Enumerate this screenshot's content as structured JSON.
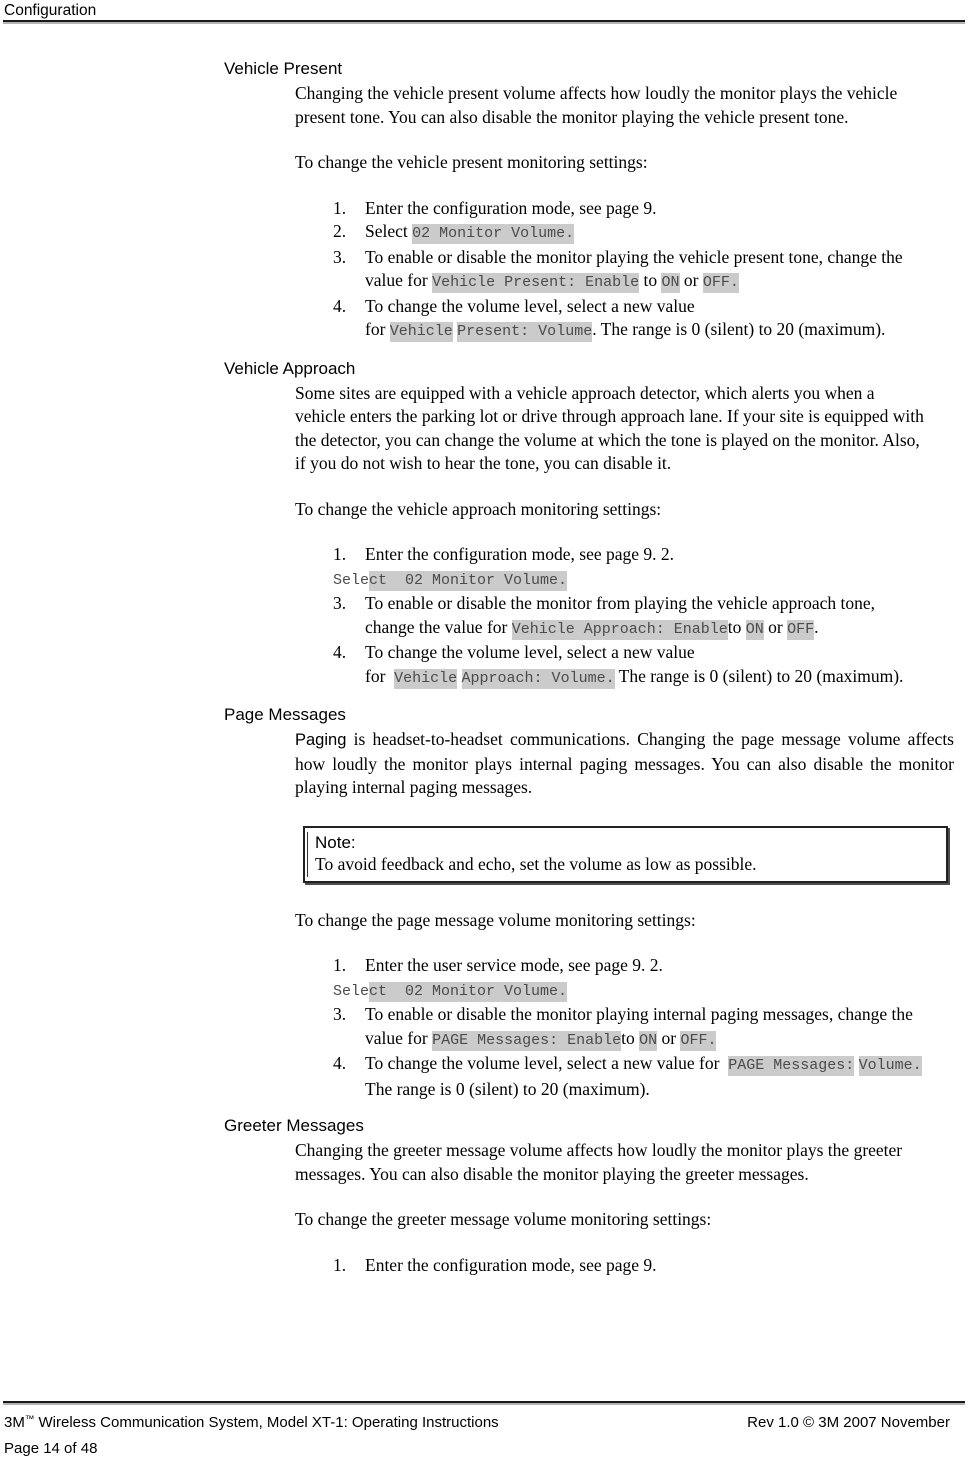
{
  "header": {
    "title": "Configuration"
  },
  "sections": [
    {
      "heading": "Vehicle Present",
      "paragraph": "Changing the vehicle present volume affects how loudly the monitor plays the vehicle present tone.  You can also disable the monitor playing the vehicle present tone.",
      "lead_in": "To change the vehicle present monitoring settings:",
      "steps": {
        "n1": "1.",
        "s1": "Enter the configuration mode, see page 9.",
        "n2": "2.",
        "s2_pre": "Select",
        "s2_code": "02 Monitor Volume.",
        "n3": "3.",
        "s3_pre": "To enable or disable the monitor playing the vehicle present tone, change the value for",
        "s3_code1": "Vehicle Present: Enable",
        "s3_mid1": "to",
        "s3_code2": "ON",
        "s3_mid2": "or",
        "s3_code3": "OFF.",
        "n4": "4.",
        "s4_pre": "To change the volume level, select a new value for",
        "s4_code1": "Vehicle",
        "s4_code2": "Present: Volume",
        "s4_post": ".  The range is 0 (silent) to 20 (maximum)."
      }
    },
    {
      "heading": "Vehicle Approach",
      "paragraph": "Some sites are equipped with a vehicle approach detector, which alerts you when a vehicle enters the parking lot or drive through approach lane.  If your site is equipped with the detector, you can change the volume at which the tone is played on the monitor.  Also, if you do not wish to hear the tone, you can disable it.",
      "lead_in": "To change the vehicle approach monitoring settings:",
      "steps": {
        "n1": "1.",
        "s1": "Enter the configuration mode, see page 9. 2.",
        "s2_pre": "Sele",
        "s2_code": "ct  02 Monitor Volume.",
        "n3": "3.",
        "s3_pre": "To enable or disable the monitor from playing the vehicle approach tone, change the value for",
        "s3_code1": "Vehicle Approach: Enable",
        "s3_mid1": "to",
        "s3_code2": "ON",
        "s3_mid2": "or",
        "s3_code3": "OFF",
        "s3_post": ".",
        "n4": "4.",
        "s4_pre": "To change the volume level, select a new value for",
        "s4_code1": "Vehicle",
        "s4_code2": "Approach: Volume.",
        "s4_post": "  The range is 0 (silent) to 20 (maximum)."
      }
    },
    {
      "heading": "Page Messages",
      "paragraph_lead": "Paging",
      "paragraph": " is headset-to-headset communications.  Changing the page message volume affects how loudly the monitor plays internal paging messages.  You can also disable the monitor playing internal paging messages.",
      "note": {
        "title": "Note:",
        "text": "To avoid feedback and echo, set the volume as low as possible."
      },
      "lead_in": "To change the page message volume monitoring settings:",
      "steps": {
        "n1": "1.",
        "s1": "Enter the user service mode, see page 9. 2.",
        "s2_pre": "Sele",
        "s2_code": "ct  02 Monitor Volume.",
        "n3": "3.",
        "s3_pre": "To enable or disable the monitor playing internal paging messages, change the value for",
        "s3_code1": "PAGE Messages: Enable",
        "s3_mid1": "to",
        "s3_code2": "ON",
        "s3_mid2": "or",
        "s3_code3": "OFF.",
        "n4": "4.",
        "s4_pre": "To change the volume level, select a new value for",
        "s4_code1": "PAGE Messages:",
        "s4_code2": "Volume.",
        "s4_post": "  The range is 0 (silent) to 20 (maximum)."
      }
    },
    {
      "heading": "Greeter Messages",
      "paragraph": "Changing the greeter message volume affects how loudly the monitor plays the greeter messages.  You can also disable the monitor playing the greeter messages.",
      "lead_in": "To change the greeter message volume monitoring settings:",
      "steps": {
        "n1": "1.",
        "s1": "Enter the configuration mode, see page 9."
      }
    }
  ],
  "footer": {
    "left_pre": "3M",
    "left_tm": "™",
    "left_post": " Wireless Communication System, Model XT-1: Operating Instructions",
    "right": "Rev 1.0 © 3M 2007 November",
    "page": "Page 14 of 48"
  },
  "colors": {
    "highlight": "#cbcbcb",
    "code_text": "#4b4b4b",
    "rule_dark": "#1a1a1a",
    "rule_light": "#b4b4b4"
  }
}
